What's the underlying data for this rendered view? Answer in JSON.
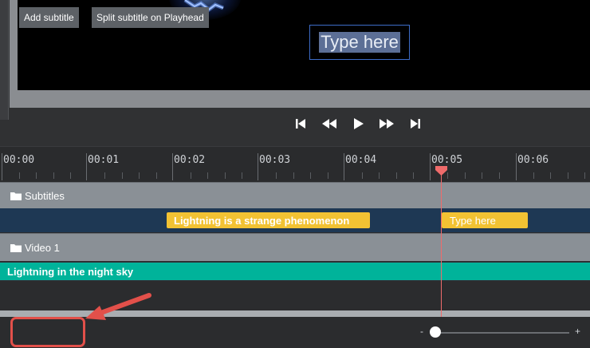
{
  "preview": {
    "text_box_value": "Type here"
  },
  "controls": {
    "skip_start_icon": "skip-to-start-icon",
    "rewind_icon": "rewind-icon",
    "play_icon": "play-icon",
    "fast_forward_icon": "fast-forward-icon",
    "skip_end_icon": "skip-to-end-icon"
  },
  "timeline": {
    "ticks": [
      "00:00",
      "00:01",
      "00:02",
      "00:03",
      "00:04",
      "00:05",
      "00:06"
    ],
    "playhead_time": "00:05"
  },
  "tracks": {
    "subtitles": {
      "name": "Subtitles",
      "clips": [
        "Lightning is a strange phenomenon",
        "Type here"
      ]
    },
    "video": {
      "name": "Video 1",
      "clips": [
        "Lightning in the night sky"
      ]
    }
  },
  "toolbar": {
    "add_subtitle_label": "Add subtitle",
    "split_label": "Split subtitle on Playhead",
    "zoom_minus": "-",
    "zoom_plus": "+"
  },
  "colors": {
    "subtitle_clip": "#f2c233",
    "video_clip": "#00b39a",
    "playhead": "#ef6b6b",
    "highlight": "#e2504a"
  }
}
